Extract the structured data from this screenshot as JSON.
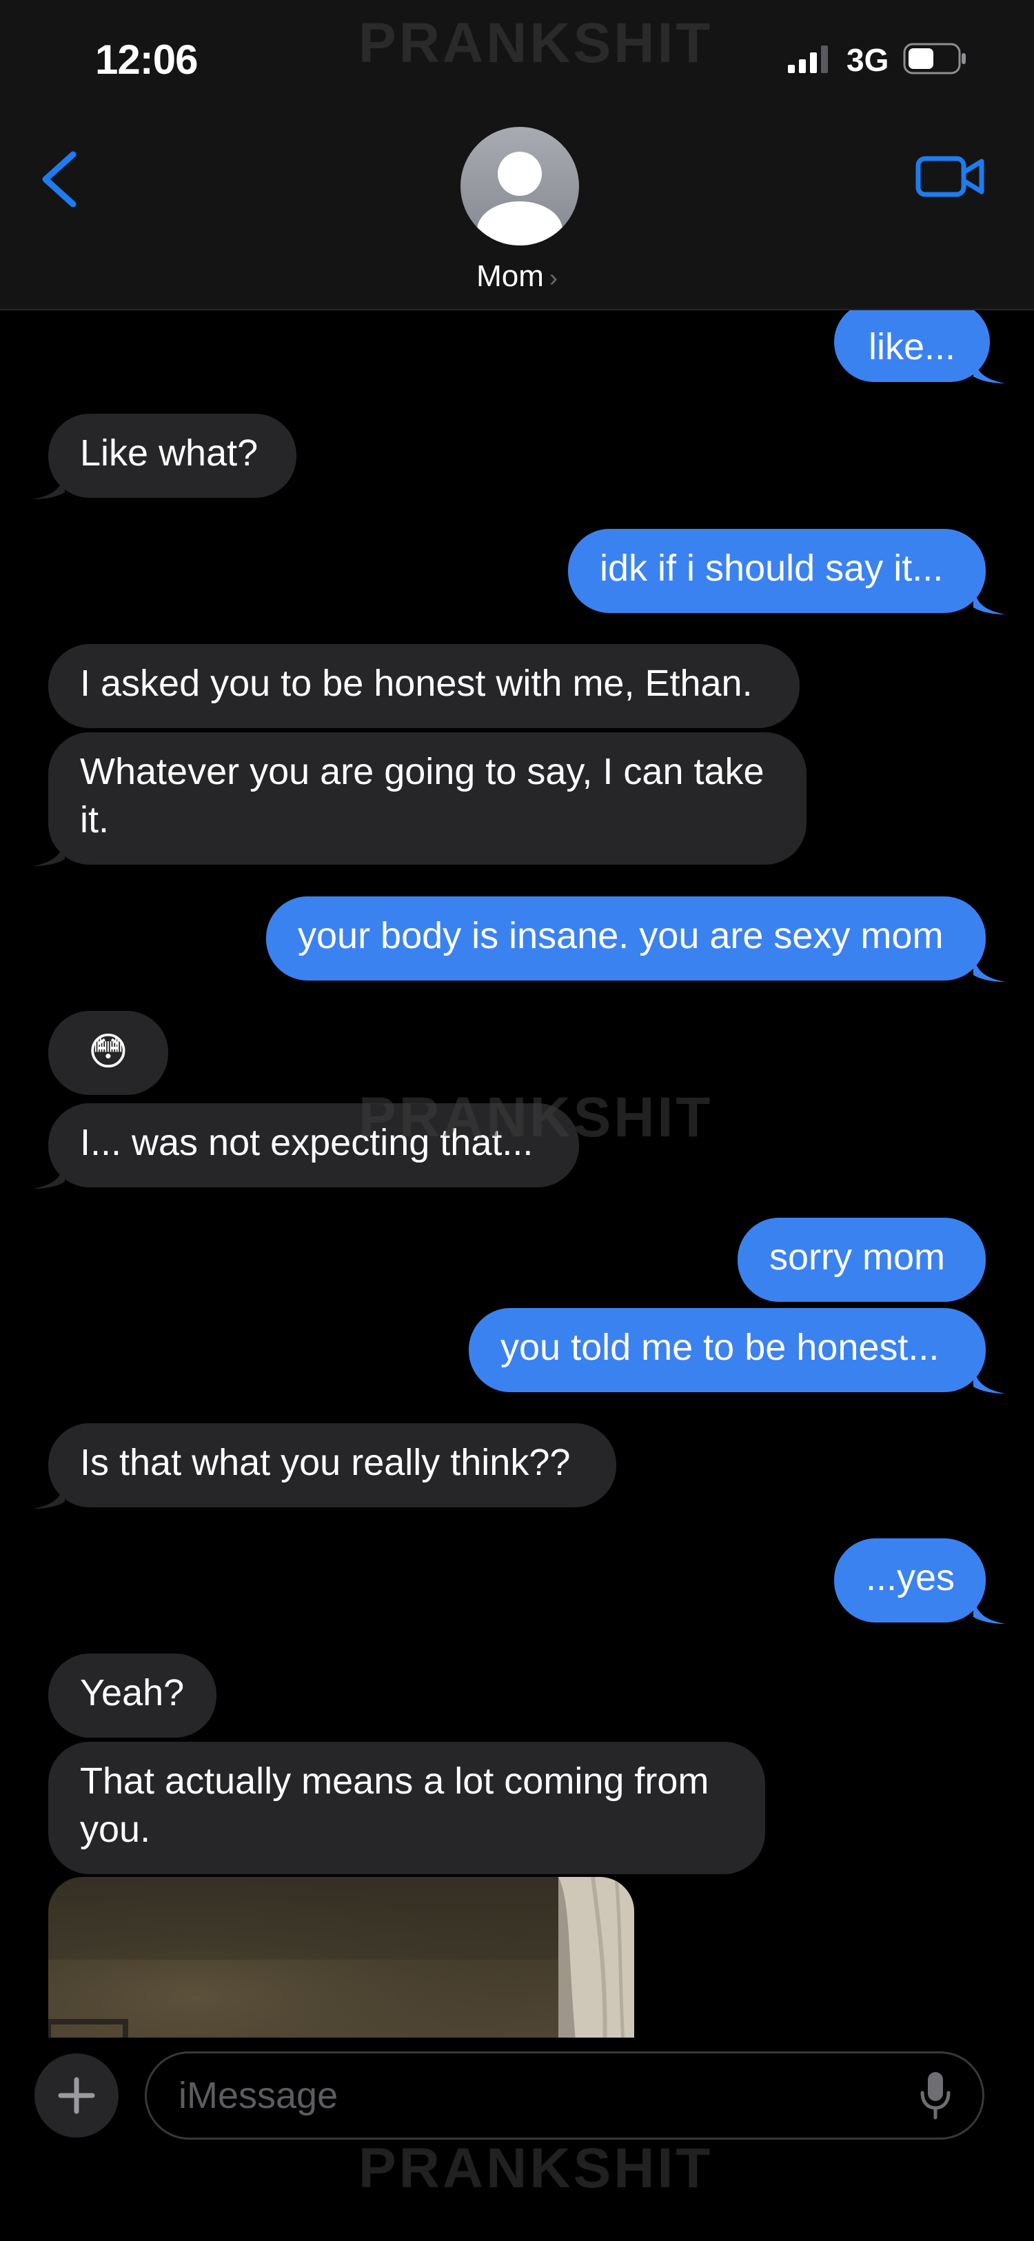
{
  "status_bar": {
    "time": "12:06",
    "network": "3G",
    "signal_icon": "cellular-signal-icon",
    "battery_icon": "battery-icon"
  },
  "watermark": "PRANKSHIT",
  "header": {
    "contact_name": "Mom",
    "chevron": "›",
    "back_icon": "chevron-left-icon",
    "video_icon": "video-camera-icon",
    "avatar_icon": "person-silhouette-icon"
  },
  "messages": [
    {
      "from": "me",
      "text": "like..."
    },
    {
      "from": "contact",
      "text": "Like what?"
    },
    {
      "from": "me",
      "text": "idk if i should say it..."
    },
    {
      "from": "contact",
      "text": "I asked you to be honest with me, Ethan."
    },
    {
      "from": "contact",
      "text": "Whatever you are going to say, I can take it."
    },
    {
      "from": "me",
      "text": "your body is insane. you are sexy mom"
    },
    {
      "from": "contact",
      "text": "😳"
    },
    {
      "from": "contact",
      "text": "I... was not expecting that..."
    },
    {
      "from": "me",
      "text": "sorry mom"
    },
    {
      "from": "me",
      "text": "you told me to be honest..."
    },
    {
      "from": "contact",
      "text": "Is that what you really think??"
    },
    {
      "from": "me",
      "text": "...yes"
    },
    {
      "from": "contact",
      "text": "Yeah?"
    },
    {
      "from": "contact",
      "text": "That actually means a lot coming from you."
    }
  ],
  "photo_attachment": {
    "from": "contact",
    "type": "photo"
  },
  "input_bar": {
    "placeholder": "iMessage",
    "add_icon": "plus-icon",
    "mic_icon": "microphone-icon"
  },
  "colors": {
    "outgoing_bubble": "#3b82f1",
    "incoming_bubble": "#262628",
    "accent": "#1e7cf0",
    "background": "#000000"
  }
}
